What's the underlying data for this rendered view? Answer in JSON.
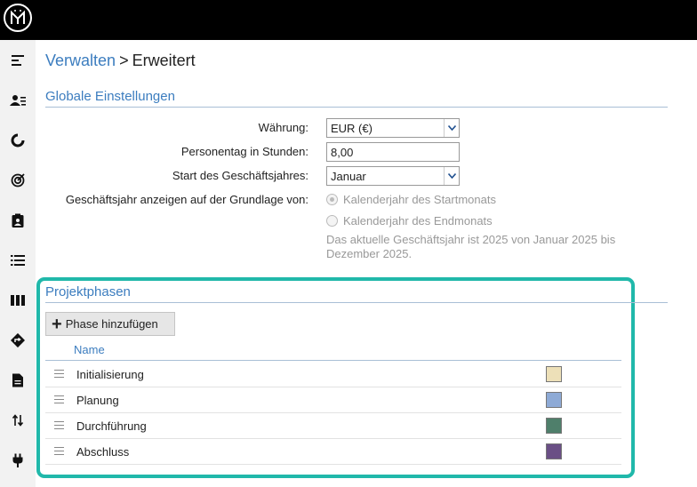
{
  "breadcrumb": {
    "parent": "Verwalten",
    "separator": ">",
    "current": "Erweitert"
  },
  "global_settings": {
    "title": "Globale Einstellungen",
    "currency_label": "Währung:",
    "currency_value": "EUR (€)",
    "personday_label": "Personentag in Stunden:",
    "personday_value": "8,00",
    "fiscal_start_label": "Start des Geschäftsjahres:",
    "fiscal_start_value": "Januar",
    "fiscal_display_label": "Geschäftsjahr anzeigen auf der Grundlage von:",
    "radio_start_label": "Kalenderjahr des Startmonats",
    "radio_end_label": "Kalenderjahr des Endmonats",
    "info_text": "Das aktuelle Geschäftsjahr ist 2025 von Januar 2025 bis Dezember 2025."
  },
  "project_phases": {
    "title": "Projektphasen",
    "add_button_label": "Phase hinzufügen",
    "column_name": "Name",
    "phases": [
      {
        "name": "Initialisierung",
        "color": "#ede0b8"
      },
      {
        "name": "Planung",
        "color": "#8eaad6"
      },
      {
        "name": "Durchführung",
        "color": "#4f7f6b"
      },
      {
        "name": "Abschluss",
        "color": "#6a4f85"
      }
    ]
  },
  "sidebar": {
    "items": [
      {
        "icon": "menu-collapse-icon"
      },
      {
        "icon": "contacts-icon"
      },
      {
        "icon": "pie-chart-icon"
      },
      {
        "icon": "target-icon"
      },
      {
        "icon": "clipboard-user-icon"
      },
      {
        "icon": "list-icon"
      },
      {
        "icon": "board-icon"
      },
      {
        "icon": "route-icon"
      },
      {
        "icon": "document-icon"
      },
      {
        "icon": "transfer-icon"
      },
      {
        "icon": "plug-icon"
      }
    ]
  },
  "colors": {
    "accent": "#3c7dbf",
    "highlight": "#20b8aa",
    "topbar": "#000000"
  }
}
